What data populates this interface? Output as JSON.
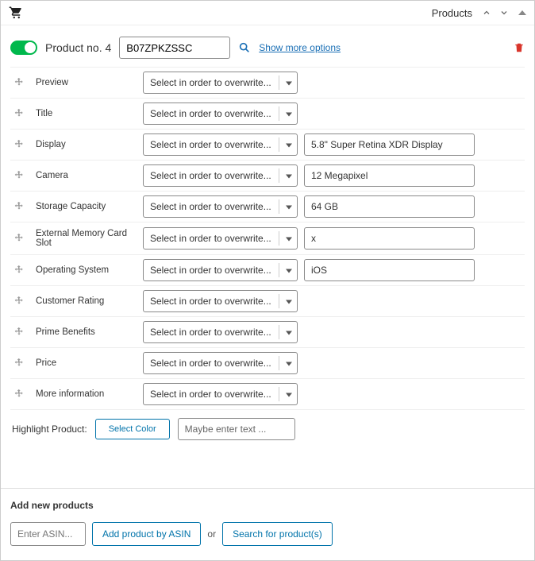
{
  "header": {
    "title": "Products"
  },
  "product": {
    "title": "Product no. 4",
    "asin": "B07ZPKZSSC",
    "show_more": "Show more options",
    "select_placeholder": "Select in order to overwrite...",
    "fields": [
      {
        "label": "Preview",
        "value": ""
      },
      {
        "label": "Title",
        "value": ""
      },
      {
        "label": "Display",
        "value": "5.8\" Super Retina XDR Display"
      },
      {
        "label": "Camera",
        "value": "12 Megapixel"
      },
      {
        "label": "Storage Capacity",
        "value": "64 GB"
      },
      {
        "label": "External Memory Card Slot",
        "value": "x"
      },
      {
        "label": "Operating System",
        "value": "iOS"
      },
      {
        "label": "Customer Rating",
        "value": ""
      },
      {
        "label": "Prime Benefits",
        "value": ""
      },
      {
        "label": "Price",
        "value": ""
      },
      {
        "label": "More information",
        "value": ""
      }
    ],
    "highlight": {
      "label": "Highlight Product:",
      "select_color": "Select Color",
      "placeholder": "Maybe enter text ..."
    }
  },
  "add": {
    "title": "Add new products",
    "asin_placeholder": "Enter ASIN...",
    "add_button": "Add product by ASIN",
    "or": "or",
    "search_button": "Search for product(s)"
  }
}
